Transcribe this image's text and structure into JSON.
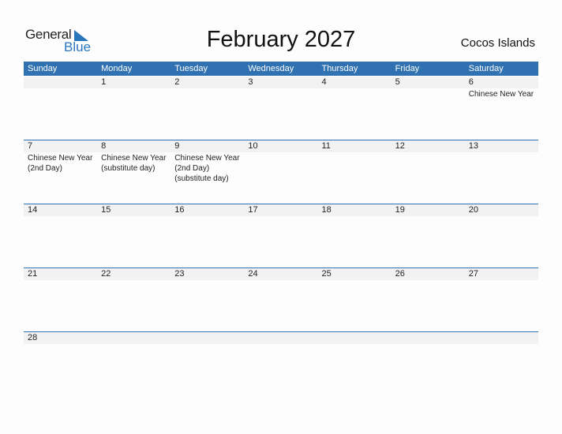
{
  "logo": {
    "general": "General",
    "blue": "Blue"
  },
  "title": "February 2027",
  "region": "Cocos Islands",
  "weekdays": [
    "Sunday",
    "Monday",
    "Tuesday",
    "Wednesday",
    "Thursday",
    "Friday",
    "Saturday"
  ],
  "weeks": [
    {
      "days": [
        "",
        "1",
        "2",
        "3",
        "4",
        "5",
        "6"
      ],
      "events": [
        "",
        "",
        "",
        "",
        "",
        "",
        "Chinese New Year"
      ]
    },
    {
      "days": [
        "7",
        "8",
        "9",
        "10",
        "11",
        "12",
        "13"
      ],
      "events": [
        "Chinese New Year\n(2nd Day)",
        "Chinese New Year\n(substitute day)",
        "Chinese New Year\n(2nd Day)\n(substitute day)",
        "",
        "",
        "",
        ""
      ]
    },
    {
      "days": [
        "14",
        "15",
        "16",
        "17",
        "18",
        "19",
        "20"
      ],
      "events": [
        "",
        "",
        "",
        "",
        "",
        "",
        ""
      ]
    },
    {
      "days": [
        "21",
        "22",
        "23",
        "24",
        "25",
        "26",
        "27"
      ],
      "events": [
        "",
        "",
        "",
        "",
        "",
        "",
        ""
      ]
    },
    {
      "days": [
        "28",
        "",
        "",
        "",
        "",
        "",
        ""
      ],
      "events": [
        "",
        "",
        "",
        "",
        "",
        "",
        ""
      ]
    }
  ]
}
